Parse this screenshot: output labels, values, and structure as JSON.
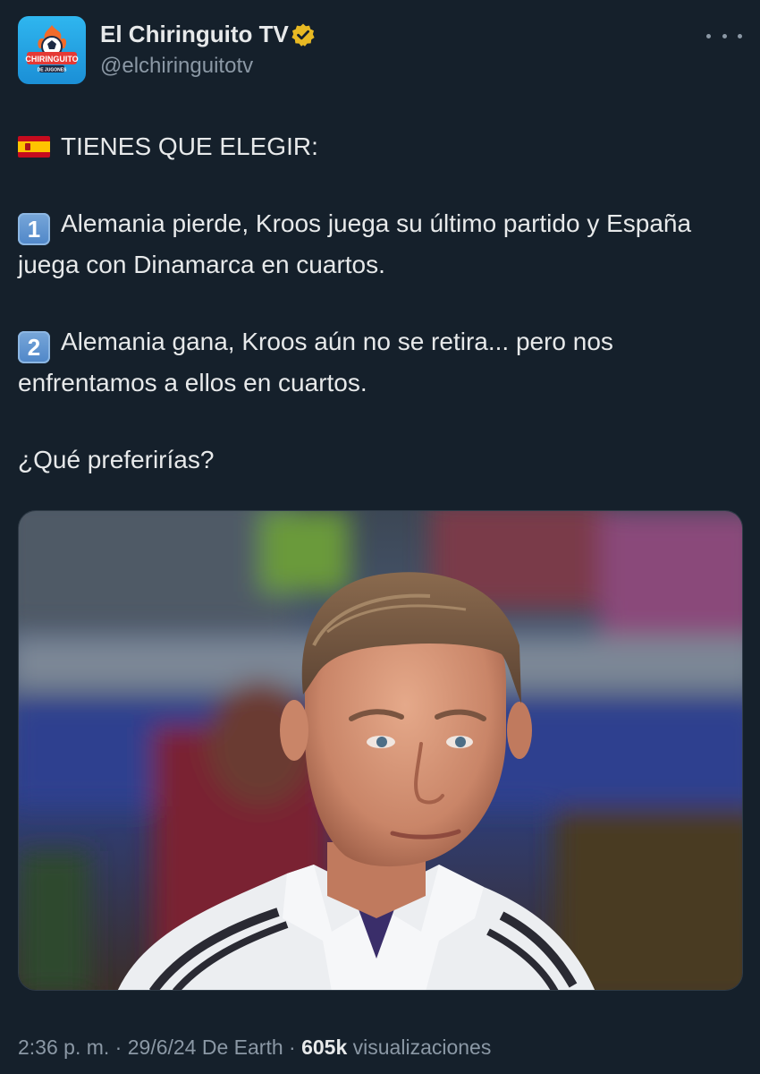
{
  "author": {
    "display_name": "El Chiringuito TV",
    "handle": "@elchiringuitotv",
    "avatar_text": "CHIRINGUITO",
    "avatar_subtext": "DE JUGONES",
    "verified": true,
    "verified_color": "#e8b923",
    "avatar_bg": "#1f9be0"
  },
  "menu_icon": "more-horizontal-icon",
  "post": {
    "headline": "TIENES QUE ELEGIR:",
    "headline_icon": "spain-flag-icon",
    "option1_key": "1",
    "option1_text": "Alemania pierde, Kroos juega su último partido y España juega con Dinamarca en cuartos.",
    "option2_key": "2",
    "option2_text": "Alemania gana, Kroos aún no se retira... pero nos enfrentamos a ellos en cuartos.",
    "question": "¿Qué preferirías?"
  },
  "media": {
    "icon": "photo-image"
  },
  "meta": {
    "time": "2:36 p. m.",
    "sep1": " · ",
    "date": "29/6/24",
    "source": " De Earth",
    "sep2": " · ",
    "views_count": "605k",
    "views_label": " visualizaciones"
  },
  "colors": {
    "background": "#15202b",
    "text_primary": "#e7e9ea",
    "text_secondary": "#8b98a5"
  }
}
